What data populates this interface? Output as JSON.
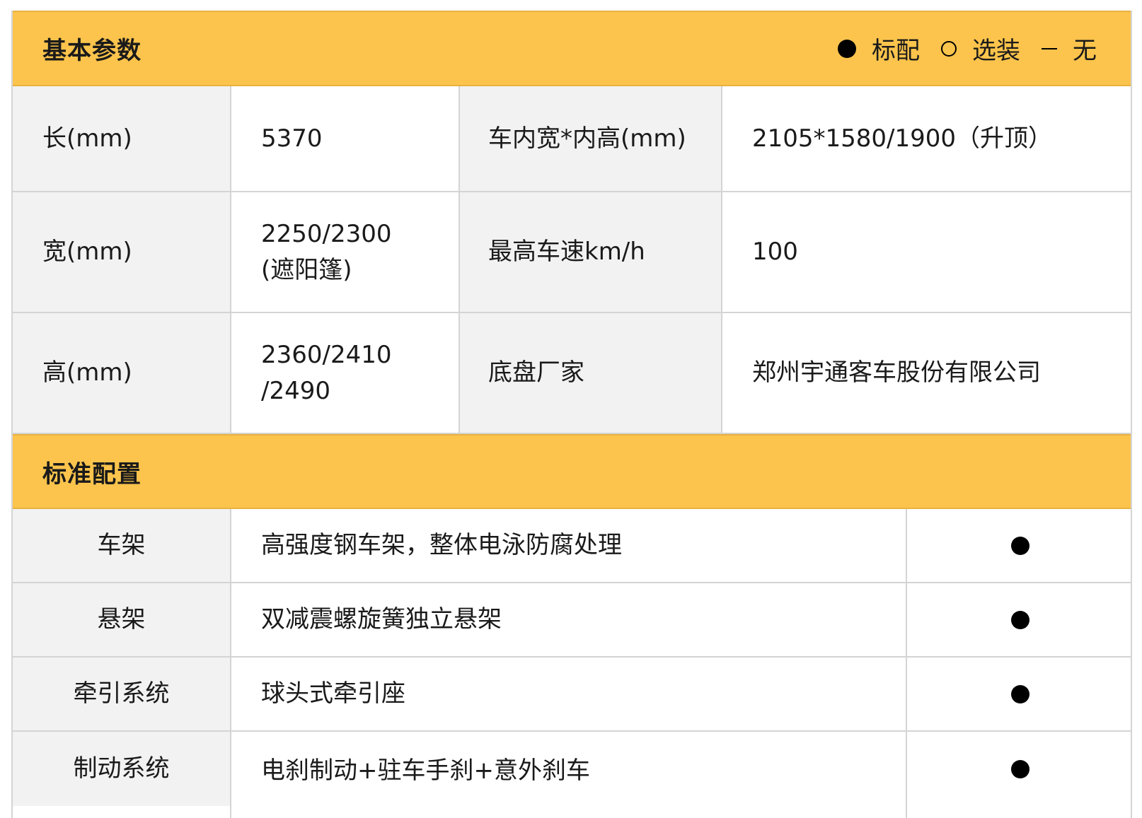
{
  "basic": {
    "title": "基本参数",
    "legend": [
      {
        "symbol": "filled-dot",
        "label": "标配"
      },
      {
        "symbol": "hollow-dot",
        "label": "选装"
      },
      {
        "symbol": "dash",
        "label": "无"
      }
    ],
    "rows": [
      {
        "label1": "长(mm)",
        "value1": "5370",
        "label2": "车内宽*内高(mm)",
        "value2": "2105*1580/1900（升顶）"
      },
      {
        "label1": "宽(mm)",
        "value1": "2250/2300\n(遮阳篷)",
        "label2": "最高车速km/h",
        "value2": "100"
      },
      {
        "label1": "高(mm)",
        "value1": "2360/2410\n/2490",
        "label2": "底盘厂家",
        "value2": "郑州宇通客车股份有限公司"
      }
    ]
  },
  "standard": {
    "title": "标准配置",
    "rows": [
      {
        "item": "车架",
        "desc": "高强度钢车架，整体电泳防腐处理",
        "status": "filled-dot"
      },
      {
        "item": "悬架",
        "desc": "双减震螺旋簧独立悬架",
        "status": "filled-dot"
      },
      {
        "item": "牵引系统",
        "desc": "球头式牵引座",
        "status": "filled-dot"
      },
      {
        "item": "制动系统",
        "desc": "电刹制动+驻车手刹+意外刹车",
        "status": "filled-dot"
      }
    ]
  },
  "colors": {
    "header_bg": "#fcc44c",
    "label_bg": "#f2f2f2",
    "border": "#d4d4d4"
  }
}
